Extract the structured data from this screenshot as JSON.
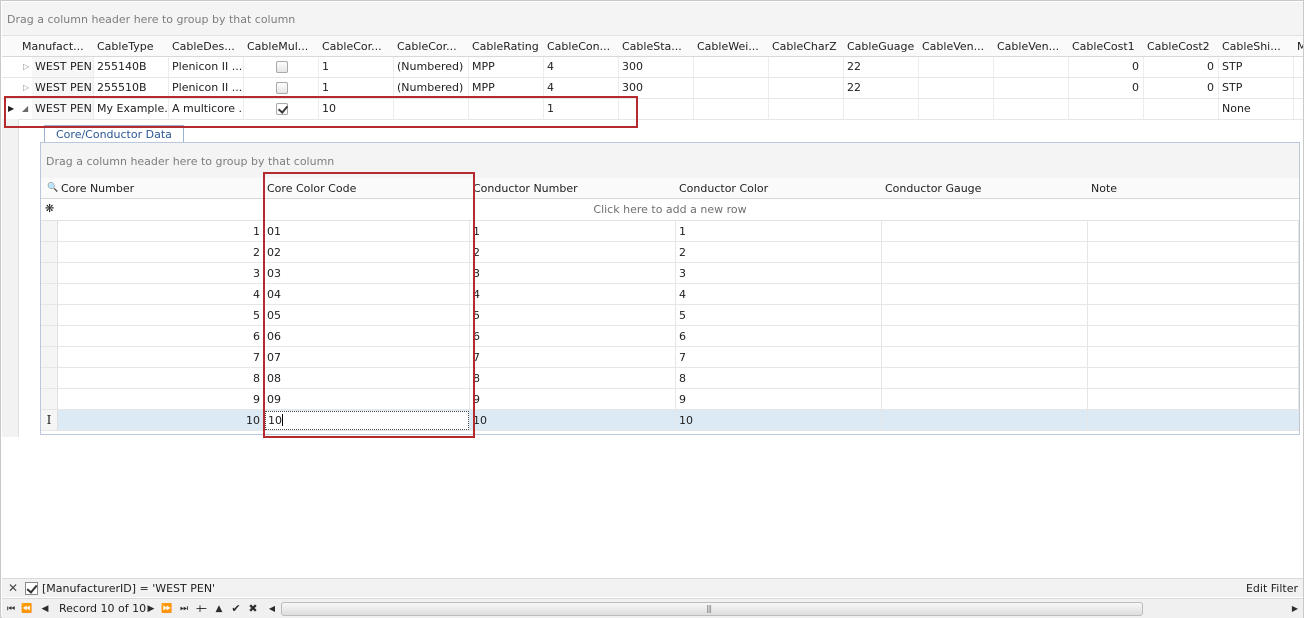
{
  "master": {
    "group_hint": "Drag a column header here to group by that column",
    "columns": [
      "Manufact...",
      "CableType",
      "CableDes...",
      "CableMul...",
      "CableCor...",
      "CableCor...",
      "CableRating",
      "CableCon...",
      "CableSta...",
      "CableWei...",
      "CableCharZ",
      "CableGuage",
      "CableVen...",
      "CableVen...",
      "CableCost1",
      "CableCost2",
      "CableShi...",
      "M"
    ],
    "rows": [
      {
        "manufacturer": "WEST PEN",
        "type": "255140B",
        "desc": "Plenicon II ...",
        "multi": false,
        "cores": "1",
        "core_numbering": "(Numbered)",
        "rating": "MPP",
        "conductors": "4",
        "standard": "300",
        "guage": "22",
        "cost1": "0",
        "cost2": "0",
        "shield": "STP"
      },
      {
        "manufacturer": "WEST PEN",
        "type": "255510B",
        "desc": "Plenicon II ...",
        "multi": false,
        "cores": "1",
        "core_numbering": "(Numbered)",
        "rating": "MPP",
        "conductors": "4",
        "standard": "300",
        "guage": "22",
        "cost1": "0",
        "cost2": "0",
        "shield": "STP"
      },
      {
        "manufacturer": "WEST PEN",
        "type": "My Example...",
        "desc": "A multicore ...",
        "multi": true,
        "cores": "10",
        "core_numbering": "",
        "rating": "",
        "conductors": "1",
        "standard": "",
        "guage": "",
        "cost1": "",
        "cost2": "",
        "shield": "None"
      }
    ]
  },
  "detail": {
    "tab_label": "Core/Conductor Data",
    "group_hint": "Drag a column header here to group by that column",
    "columns": [
      "Core Number",
      "Core Color Code",
      "Conductor Number",
      "Conductor Color",
      "Conductor Gauge",
      "Note"
    ],
    "new_row_hint": "Click here to add a new row",
    "rows": [
      {
        "core": "1",
        "color_code": "01",
        "conductor": "1",
        "conductor_color": "1"
      },
      {
        "core": "2",
        "color_code": "02",
        "conductor": "2",
        "conductor_color": "2"
      },
      {
        "core": "3",
        "color_code": "03",
        "conductor": "3",
        "conductor_color": "3"
      },
      {
        "core": "4",
        "color_code": "04",
        "conductor": "4",
        "conductor_color": "4"
      },
      {
        "core": "5",
        "color_code": "05",
        "conductor": "5",
        "conductor_color": "5"
      },
      {
        "core": "6",
        "color_code": "06",
        "conductor": "6",
        "conductor_color": "6"
      },
      {
        "core": "7",
        "color_code": "07",
        "conductor": "7",
        "conductor_color": "7"
      },
      {
        "core": "8",
        "color_code": "08",
        "conductor": "8",
        "conductor_color": "8"
      },
      {
        "core": "9",
        "color_code": "09",
        "conductor": "9",
        "conductor_color": "9"
      },
      {
        "core": "10",
        "color_code": "10",
        "conductor": "10",
        "conductor_color": "10"
      }
    ]
  },
  "filter": {
    "expression": "[ManufacturerID] = 'WEST PEN'",
    "edit_label": "Edit Filter"
  },
  "navigator": {
    "record_text": "Record 10 of 10"
  },
  "colors": {
    "highlight_box": "#b42a2f",
    "selected_row": "#dceaf6",
    "tab_text": "#2b5796"
  }
}
